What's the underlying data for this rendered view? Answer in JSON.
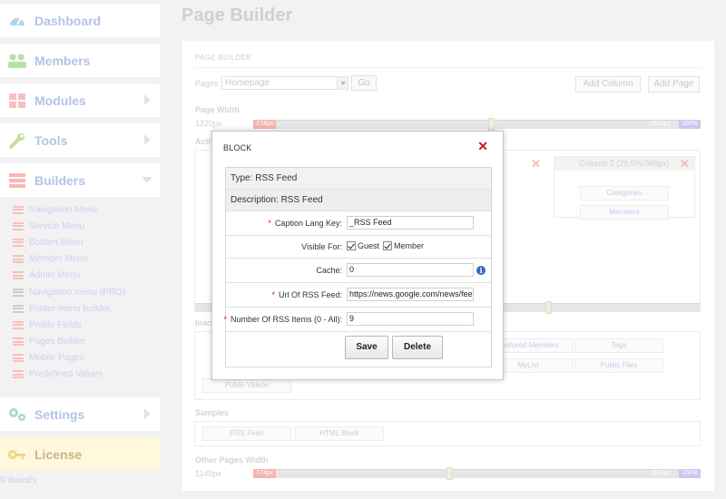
{
  "sidebar": {
    "items": [
      {
        "label": "Dashboard",
        "icon": "gauge-icon"
      },
      {
        "label": "Members",
        "icon": "members-icon"
      },
      {
        "label": "Modules",
        "icon": "modules-icon"
      },
      {
        "label": "Tools",
        "icon": "wrench-icon"
      },
      {
        "label": "Builders",
        "icon": "builders-icon"
      },
      {
        "label": "Settings",
        "icon": "gears-icon"
      },
      {
        "label": "License",
        "icon": "key-icon"
      }
    ],
    "builders_sub": [
      "Navigation Menu",
      "Service Menu",
      "Bottom Menu",
      "Member Menu",
      "Admin Menu",
      "Navigation menu (PRO)",
      "Footer menu builder",
      "Profile Fields",
      "Pages Builder",
      "Mobile Pages",
      "Predefined Values"
    ],
    "copyright": "© BoonEx"
  },
  "main": {
    "title": "Page Builder",
    "panel_header": "PAGE BUILDER",
    "pages_label": "Pages:",
    "pages_selected": "Homepage",
    "go": "Go",
    "add_column": "Add Column",
    "add_page": "Add Page",
    "page_width_label": "Page Width",
    "page_width_value": "1220px",
    "page_width_slider": {
      "lo": "774px",
      "hi": "100%",
      "mid": "1600px"
    },
    "active_label": "Active",
    "inactive_label": "Inactive",
    "column2_title": "Column 2 (29.9%/365px)",
    "column2_blocks": [
      "Categories",
      "Members"
    ],
    "inactive_blocks": [
      "Featured Members",
      "Tags",
      "MyList",
      "Public Files",
      "Public Videos"
    ],
    "samples_label": "Samples",
    "samples_blocks": [
      "RSS Feed",
      "HTML Block"
    ],
    "other_width_label": "Other Pages Width",
    "other_width_value": "1140px",
    "other_width_slider": {
      "lo": "774px",
      "hi": "100%",
      "mid": "1600px"
    }
  },
  "dialog": {
    "title": "BLOCK",
    "type_text": "Type: RSS Feed",
    "description_text": "Description: RSS Feed",
    "fields": {
      "caption_label": "Caption Lang Key:",
      "caption_value": "_RSS Feed",
      "visible_label": "Visible For:",
      "visible_guest": "Guest",
      "visible_member": "Member",
      "cache_label": "Cache:",
      "cache_value": "0",
      "url_label": "Url Of RSS Feed:",
      "url_value": "https://news.google.com/news/feed",
      "num_label": "Number Of RSS Items (0 - All):",
      "num_value": "9"
    },
    "save": "Save",
    "delete": "Delete",
    "required_mark": "*",
    "close_glyph": "✕",
    "info_glyph": "i"
  }
}
